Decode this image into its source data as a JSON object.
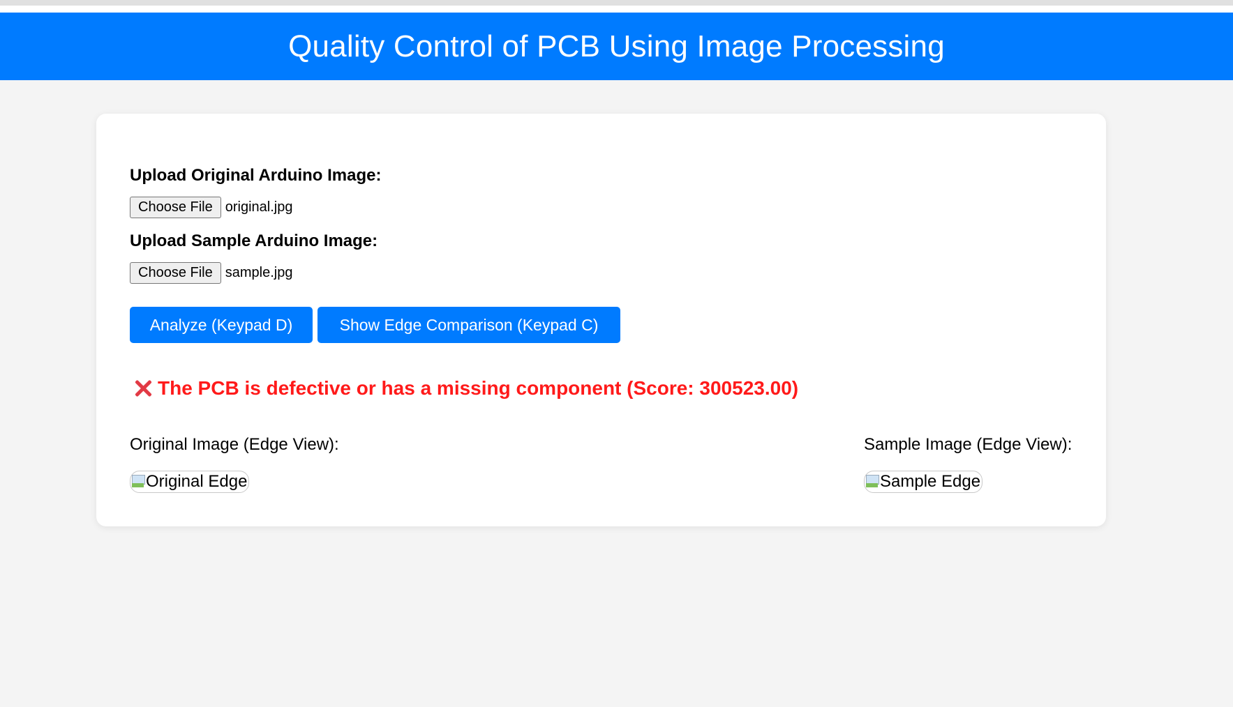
{
  "header": {
    "title": "Quality Control of PCB Using Image Processing"
  },
  "upload_original": {
    "label": "Upload Original Arduino Image:",
    "button_label": "Choose File",
    "file_name": "original.jpg"
  },
  "upload_sample": {
    "label": "Upload Sample Arduino Image:",
    "button_label": "Choose File",
    "file_name": "sample.jpg"
  },
  "actions": {
    "analyze_label": "Analyze (Keypad D)",
    "edge_label": "Show Edge Comparison (Keypad C)"
  },
  "result": {
    "icon": "cross-mark-icon",
    "text": "The PCB is defective or has a missing component (Score: 300523.00)",
    "color": "#ff1a1a"
  },
  "edge_views": {
    "original_label": "Original Image (Edge View):",
    "original_alt": "Original Edge",
    "sample_label": "Sample Image (Edge View):",
    "sample_alt": "Sample Edge"
  },
  "colors": {
    "accent": "#007bff",
    "background": "#f4f4f4",
    "card": "#ffffff"
  }
}
